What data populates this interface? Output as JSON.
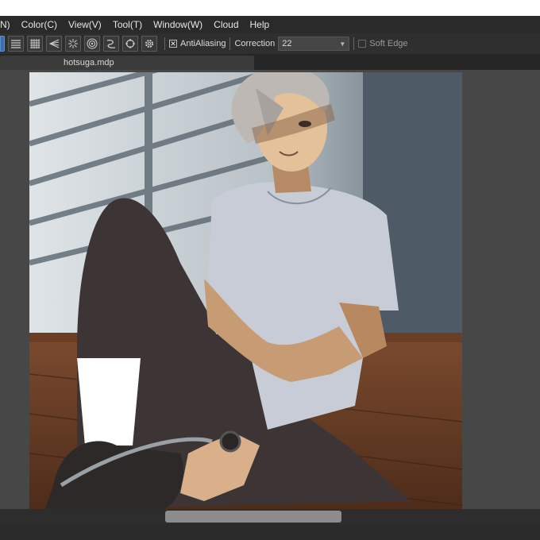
{
  "menu": {
    "items": [
      "N)",
      "Color(C)",
      "View(V)",
      "Tool(T)",
      "Window(W)",
      "Cloud",
      "Help"
    ]
  },
  "toolbar": {
    "antialiasing_label": "AntiAliasing",
    "antialiasing_checked": true,
    "correction_label": "Correction",
    "correction_value": "22",
    "soft_edge_label": "Soft Edge",
    "soft_edge_checked": false
  },
  "document": {
    "tab_title": "hotsuga.mdp"
  },
  "colors": {
    "accent": "#3d6fb0",
    "menubar": "#2a2a2a",
    "toolbar": "#2f2f2f",
    "workspace": "#474747"
  },
  "icons": [
    "select-tool-icon",
    "hatch-lines-icon",
    "grid-icon",
    "perspective-icon",
    "radial-lines-icon",
    "concentric-icon",
    "curve-icon",
    "circle-dots-icon",
    "gear-icon"
  ]
}
